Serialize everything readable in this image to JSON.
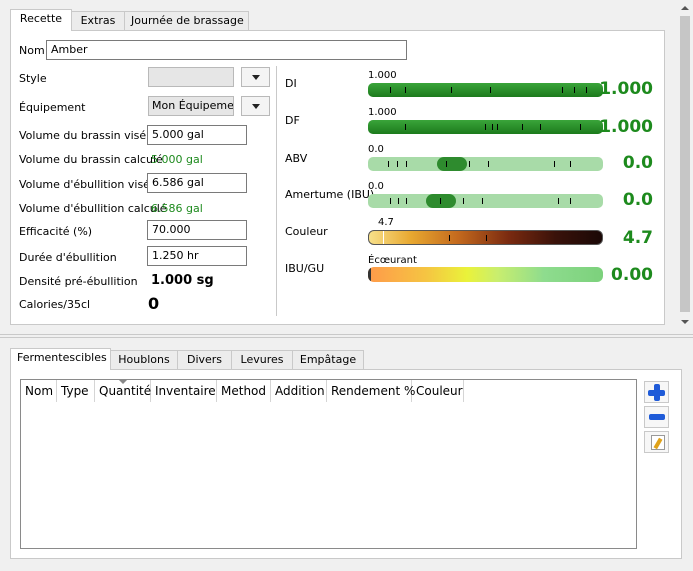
{
  "top_tabs": [
    "Recette",
    "Extras",
    "Journée de brassage"
  ],
  "recipe": {
    "name_label": "Nom",
    "name_value": "Amber",
    "style_label": "Style",
    "style_value": "",
    "equipment_label": "Équipement",
    "equipment_value": "Mon Équipement",
    "batch_target_label": "Volume du brassin visé",
    "batch_target_value": "5.000 gal",
    "batch_calc_label": "Volume du brassin calculé",
    "batch_calc_value": "5.000 gal",
    "boil_target_label": "Volume d'ébullition visé",
    "boil_target_value": "6.586 gal",
    "boil_calc_label": "Volume d'ébullition calculé",
    "boil_calc_value": "6.586 gal",
    "efficiency_label": "Efficacité (%)",
    "efficiency_value": "70.000",
    "boil_time_label": "Durée d'ébullition",
    "boil_time_value": "1.250 hr",
    "preboil_label": "Densité pré-ébullition",
    "preboil_value": "1.000 sg",
    "calories_label": "Calories/35cl",
    "calories_value": "0"
  },
  "gauges": {
    "og": {
      "label": "DI",
      "bar_text": "1.000",
      "value": "1.000",
      "fill": 1.0
    },
    "fg": {
      "label": "DF",
      "bar_text": "1.000",
      "value": "1.000",
      "fill": 1.0
    },
    "abv": {
      "label": "ABV",
      "bar_text": "0.0",
      "value": "0.0",
      "knob": 0.35
    },
    "ibu": {
      "label": "Amertume (IBU)",
      "bar_text": "0.0",
      "value": "0.0",
      "knob": 0.31
    },
    "color": {
      "label": "Couleur",
      "bar_text": "4.7",
      "value": "4.7"
    },
    "bugu": {
      "label": "IBU/GU",
      "bar_text": "Écœurant",
      "value": "0.00"
    }
  },
  "bottom_tabs": [
    "Fermentescibles",
    "Houblons",
    "Divers",
    "Levures",
    "Empâtage"
  ],
  "table_columns": [
    "Nom",
    "Type",
    "Quantité",
    "Inventaire",
    "Method",
    "Addition",
    "Rendement %",
    "Couleur"
  ],
  "side_buttons": [
    "add-icon",
    "remove-icon",
    "edit-icon"
  ]
}
